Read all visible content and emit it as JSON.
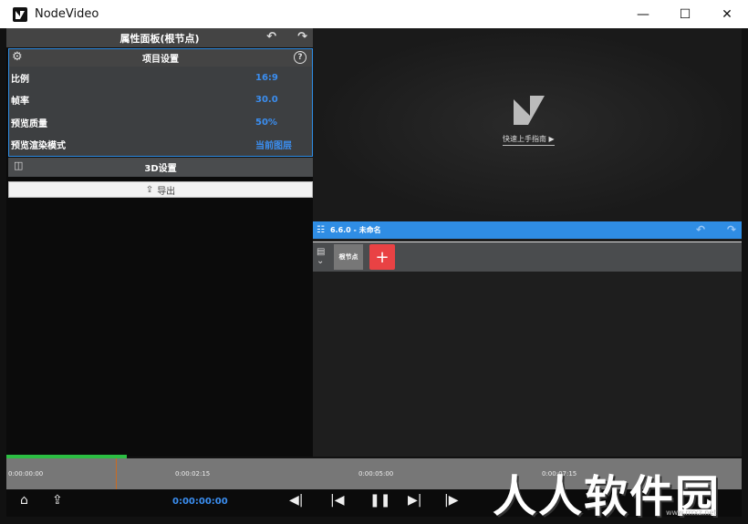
{
  "window": {
    "title": "NodeVideo"
  },
  "properties": {
    "title": "属性面板(根节点)"
  },
  "project": {
    "title": "项目设置",
    "rows": [
      {
        "label": "比例",
        "value": "16:9"
      },
      {
        "label": "帧率",
        "value": "30.0"
      },
      {
        "label": "预览质量",
        "value": "50%"
      },
      {
        "label": "预览渲染模式",
        "value": "当前图层"
      }
    ]
  },
  "section3d": {
    "label": "3D设置"
  },
  "export": {
    "label": "导出"
  },
  "preview": {
    "guide": "快速上手指南"
  },
  "nodes": {
    "title": "6.6.0 - 未命名",
    "root": "根节点"
  },
  "timeline": {
    "ticks": [
      "0:00:00:00",
      "0:00:02:15",
      "0:00:05:00",
      "0:00:07:15"
    ],
    "timecode": "0:00:00:00"
  },
  "watermark": {
    "text": "人人软件园",
    "url": "www.rrrxz.net"
  }
}
